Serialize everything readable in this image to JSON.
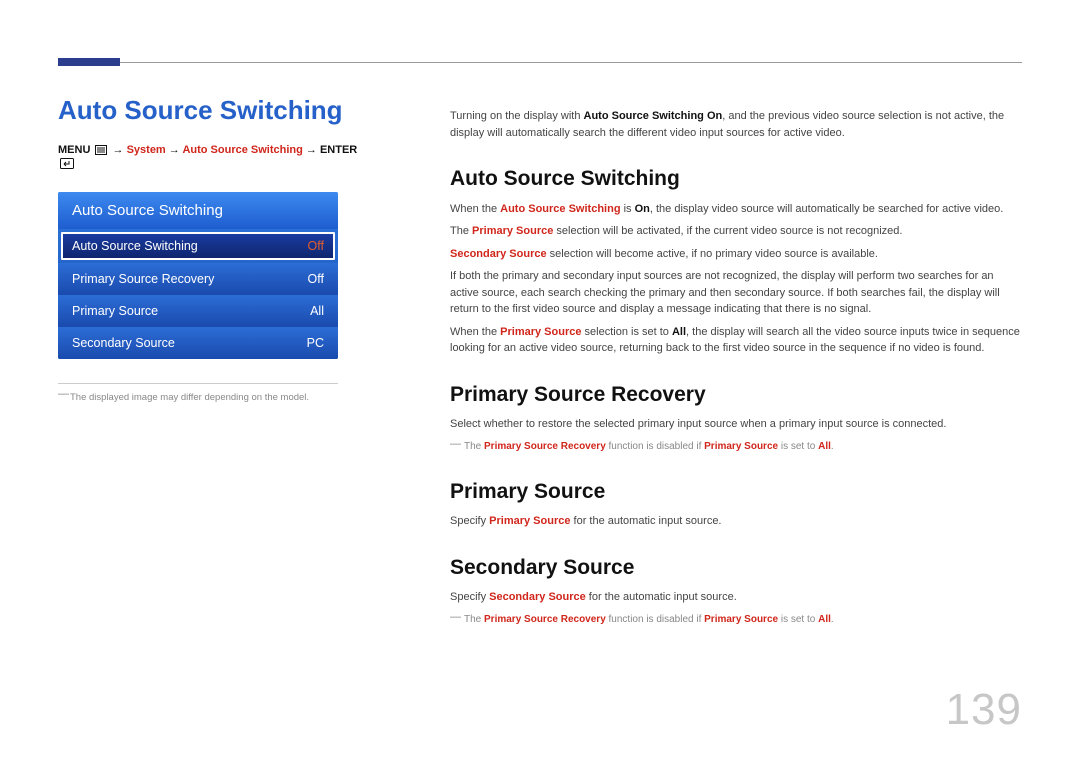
{
  "header": {
    "title": "Auto Source Switching"
  },
  "breadcrumb": {
    "menu_label": "MENU",
    "arrow": "→",
    "system": "System",
    "auto_source": "Auto Source Switching",
    "enter_label": "ENTER"
  },
  "menu": {
    "header": "Auto Source Switching",
    "items": [
      {
        "label": "Auto Source Switching",
        "value": "Off",
        "selected": true
      },
      {
        "label": "Primary Source Recovery",
        "value": "Off",
        "selected": false
      },
      {
        "label": "Primary Source",
        "value": "All",
        "selected": false
      },
      {
        "label": "Secondary Source",
        "value": "PC",
        "selected": false
      }
    ]
  },
  "left_footnote": "The displayed image may differ depending on the model.",
  "content": {
    "intro_1": "Turning on the display with ",
    "intro_bold": "Auto Source Switching On",
    "intro_2": ", and the previous video source selection is not active, the display will automatically search the different video input sources for active video.",
    "s1": {
      "heading": "Auto Source Switching",
      "p1a": "When the ",
      "p1b": "Auto Source Switching",
      "p1c": " is ",
      "p1d": "On",
      "p1e": ", the display video source will automatically be searched for active video.",
      "p2a": "The ",
      "p2b": "Primary Source",
      "p2c": " selection will be activated, if the current video source is not recognized.",
      "p3a": "Secondary Source",
      "p3b": " selection will become active, if no primary video source is available.",
      "p4": "If both the primary and secondary input sources are not recognized, the display will perform two searches for an active source, each search checking the primary and then secondary source. If both searches fail, the display will return to the first video source and display a message indicating that there is no signal.",
      "p5a": "When the ",
      "p5b": "Primary Source",
      "p5c": " selection is set to ",
      "p5d": "All",
      "p5e": ", the display will search all the video source inputs twice in sequence looking for an active video source, returning back to the first video source in the sequence if no video is found."
    },
    "s2": {
      "heading": "Primary Source Recovery",
      "p1": "Select whether to restore the selected primary input source when a primary input source is connected.",
      "note_a": "The ",
      "note_b": "Primary Source Recovery",
      "note_c": " function is disabled if ",
      "note_d": "Primary Source",
      "note_e": " is set to ",
      "note_f": "All",
      "note_g": "."
    },
    "s3": {
      "heading": "Primary Source",
      "p1a": "Specify ",
      "p1b": "Primary Source",
      "p1c": " for the automatic input source."
    },
    "s4": {
      "heading": "Secondary Source",
      "p1a": "Specify ",
      "p1b": "Secondary Source",
      "p1c": " for the automatic input source.",
      "note_a": "The ",
      "note_b": "Primary Source Recovery",
      "note_c": " function is disabled if ",
      "note_d": "Primary Source",
      "note_e": " is set to ",
      "note_f": "All",
      "note_g": "."
    }
  },
  "page_number": "139"
}
